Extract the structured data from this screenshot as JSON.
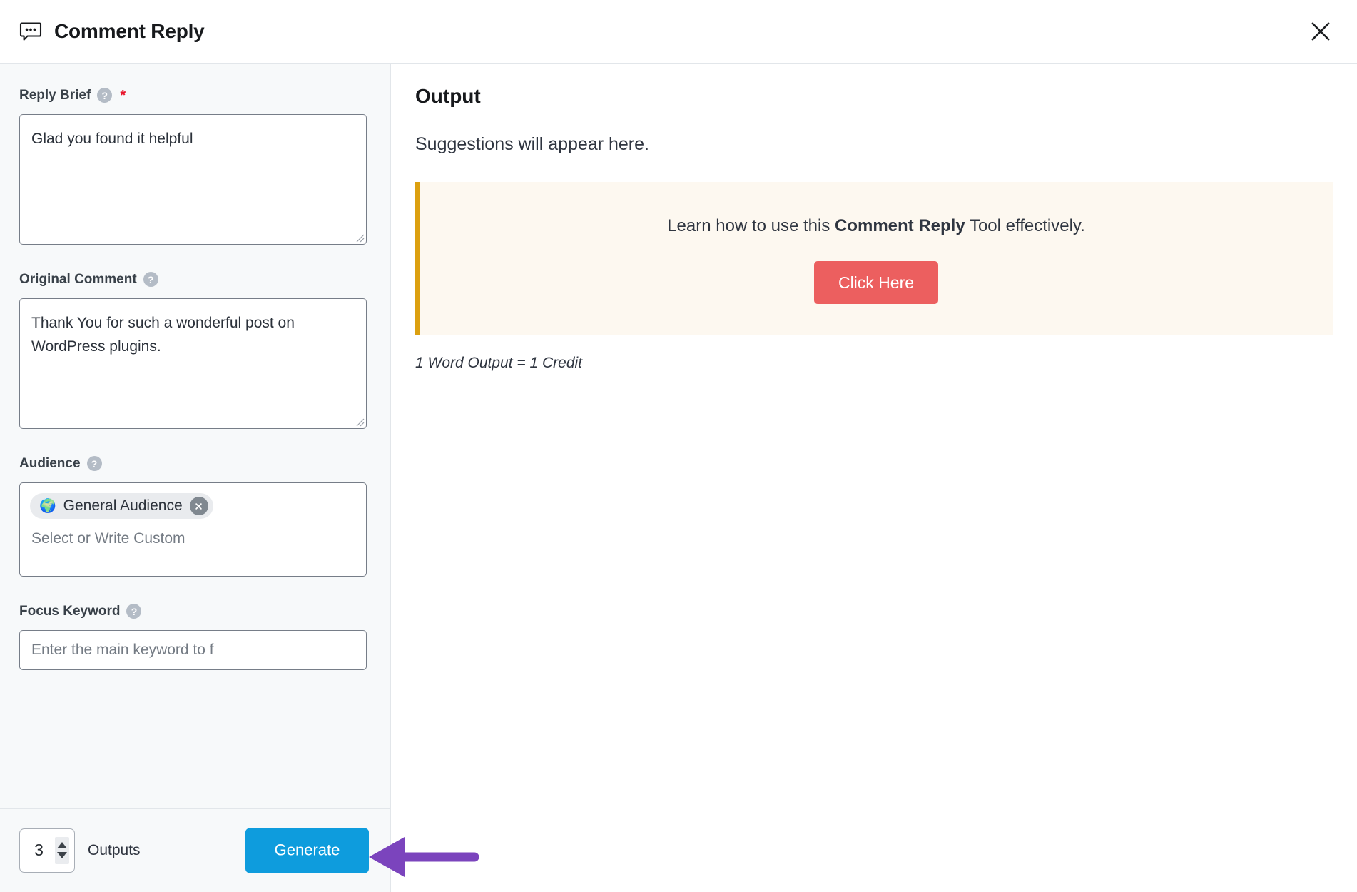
{
  "header": {
    "title": "Comment Reply",
    "icon": "comment-bubble-icon",
    "close_label": "×"
  },
  "form": {
    "fields": [
      {
        "id": "reply-brief",
        "label": "Reply Brief",
        "help_icon": "?",
        "required": true,
        "required_marker": "*",
        "value": "Glad you found it helpful",
        "placeholder": ""
      },
      {
        "id": "original-comment",
        "label": "Original Comment",
        "help_icon": "?",
        "required": false,
        "value": "Thank You for such a wonderful post on WordPress plugins.",
        "placeholder": ""
      },
      {
        "id": "audience",
        "label": "Audience",
        "help_icon": "?",
        "required": false,
        "placeholder": "Select or Write Custom",
        "chips": [
          {
            "emoji": "🌍",
            "label": "General Audience",
            "remove_icon": "close-icon"
          }
        ]
      },
      {
        "id": "focus-keyword",
        "label": "Focus Keyword",
        "help_icon": "?",
        "required": false,
        "value": "",
        "placeholder": "Enter the main keyword to f"
      }
    ]
  },
  "footer": {
    "outputs_count": "3",
    "outputs_label": "Outputs",
    "generate_label": "Generate"
  },
  "output": {
    "title": "Output",
    "hint": "Suggestions will appear here.",
    "notice": {
      "text_before": "Learn how to use this ",
      "text_bold": "Comment Reply",
      "text_after": " Tool effectively.",
      "button_label": "Click Here"
    },
    "credit_note": "1 Word Output = 1 Credit"
  },
  "colors": {
    "generate_blue": "#0e9cdd",
    "notice_bg": "#fdf8f0",
    "notice_border": "#dca010",
    "notice_button_red": "#ec5f5f",
    "annotation_purple": "#7b44bd",
    "required_red": "#e8142a",
    "panel_bg": "#f7f9fa"
  }
}
